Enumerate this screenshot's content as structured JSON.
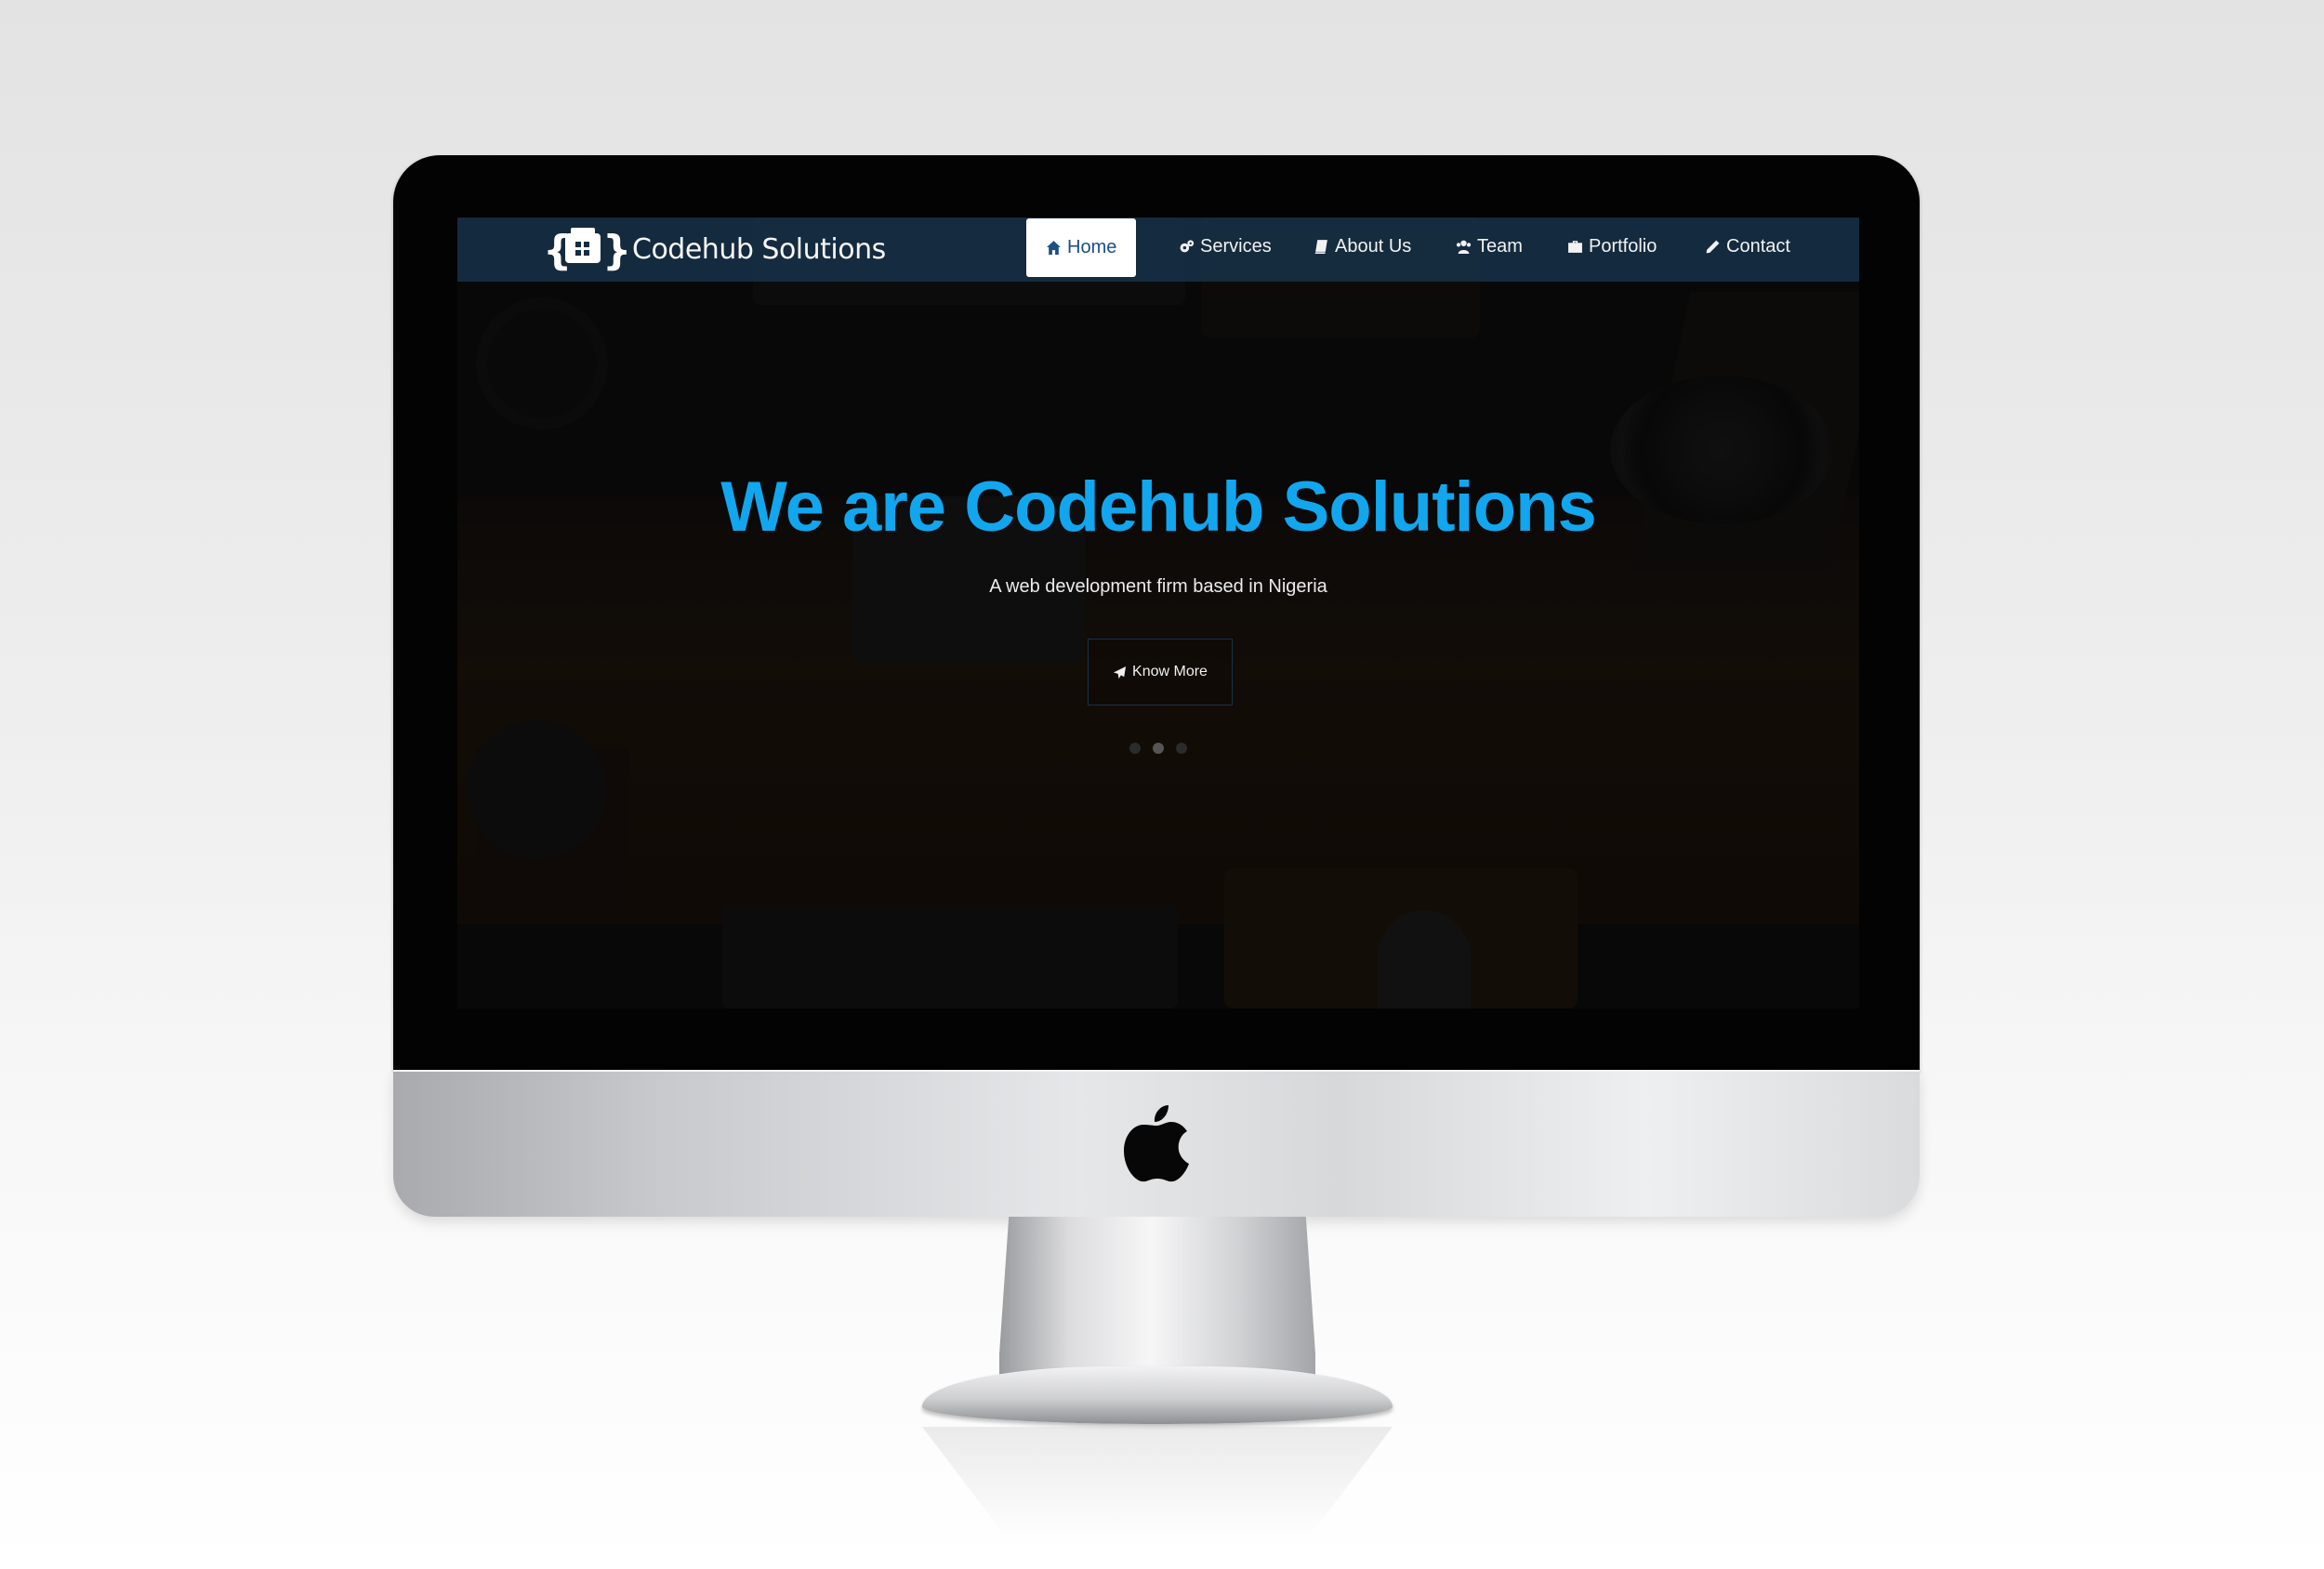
{
  "brand": {
    "name": "Codehub Solutions"
  },
  "nav": {
    "items": [
      {
        "label": "Home",
        "icon": "home-icon",
        "active": true
      },
      {
        "label": "Services",
        "icon": "gears-icon",
        "active": false
      },
      {
        "label": "About Us",
        "icon": "book-icon",
        "active": false
      },
      {
        "label": "Team",
        "icon": "users-icon",
        "active": false
      },
      {
        "label": "Portfolio",
        "icon": "briefcase-icon",
        "active": false
      },
      {
        "label": "Contact",
        "icon": "pencil-icon",
        "active": false
      }
    ]
  },
  "hero": {
    "title": "We are Codehub Solutions",
    "subtitle": "A web development firm based in Nigeria",
    "cta_label": "Know More",
    "cta_icon": "paper-plane-icon",
    "slides_count": 3,
    "active_slide": 2
  },
  "colors": {
    "accent": "#12a6ee",
    "navbar": "#152c42",
    "active_nav_text": "#1c4f86"
  },
  "device": {
    "logo": "apple-logo-icon"
  }
}
